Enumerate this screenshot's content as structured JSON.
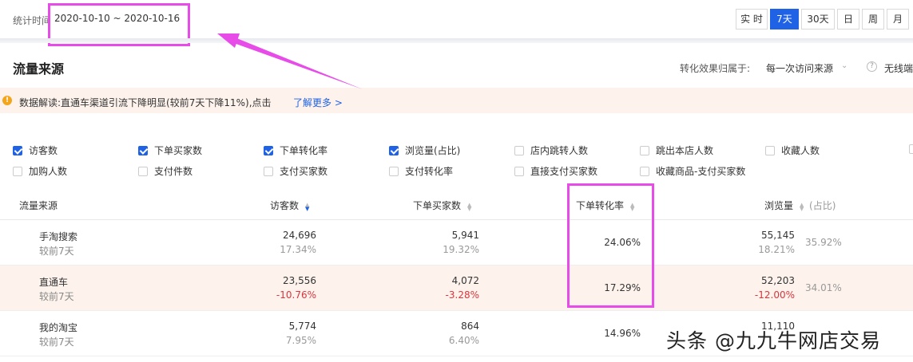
{
  "header": {
    "stat_label": "统计时间",
    "date_range": "2020-10-10 ~ 2020-10-16",
    "periods": [
      {
        "label": "实 时",
        "active": false
      },
      {
        "label": "7天",
        "active": true
      },
      {
        "label": "30天",
        "active": false
      },
      {
        "label": "日",
        "active": false
      },
      {
        "label": "周",
        "active": false
      },
      {
        "label": "月",
        "active": false
      }
    ]
  },
  "section": {
    "title": "流量来源",
    "attribution_label": "转化效果归属于:",
    "attribution_value": "每一次访问来源",
    "no_wireless": "无线端"
  },
  "notice": {
    "text": "数据解读:直通车渠道引流下降明显(较前7天下降11%),点击",
    "link": "了解更多 >"
  },
  "metrics": [
    {
      "label": "访客数",
      "checked": true
    },
    {
      "label": "下单买家数",
      "checked": true
    },
    {
      "label": "下单转化率",
      "checked": true
    },
    {
      "label": "浏览量(占比)",
      "checked": true
    },
    {
      "label": "店内跳转人数",
      "checked": false
    },
    {
      "label": "跳出本店人数",
      "checked": false
    },
    {
      "label": "收藏人数",
      "checked": false
    },
    {
      "label": "加购人数",
      "checked": false
    },
    {
      "label": "支付件数",
      "checked": false
    },
    {
      "label": "支付买家数",
      "checked": false
    },
    {
      "label": "支付转化率",
      "checked": false
    },
    {
      "label": "直接支付买家数",
      "checked": false
    },
    {
      "label": "收藏商品-支付买家数",
      "checked": false
    }
  ],
  "table": {
    "headers": {
      "source": "流量来源",
      "visitors": "访客数",
      "buyers": "下单买家数",
      "conversion": "下单转化率",
      "pageviews": "浏览量",
      "share": "(占比)"
    },
    "compare_label": "较前7天",
    "rows": [
      {
        "source": "手淘搜索",
        "visitors": "24,696",
        "visitors_change": "17.34%",
        "visitors_down": false,
        "buyers": "5,941",
        "buyers_change": "19.32%",
        "buyers_down": false,
        "conversion": "24.06%",
        "pageviews": "55,145",
        "pageviews_change": "18.21%",
        "pageviews_down": false,
        "share": "35.92%"
      },
      {
        "source": "直通车",
        "visitors": "23,556",
        "visitors_change": "-10.76%",
        "visitors_down": true,
        "buyers": "4,072",
        "buyers_change": "-3.28%",
        "buyers_down": true,
        "conversion": "17.29%",
        "pageviews": "52,203",
        "pageviews_change": "-12.00%",
        "pageviews_down": true,
        "share": "34.01%"
      },
      {
        "source": "我的淘宝",
        "visitors": "5,774",
        "visitors_change": "7.95%",
        "visitors_down": false,
        "buyers": "864",
        "buyers_change": "6.40%",
        "buyers_down": false,
        "conversion": "14.96%",
        "pageviews": "11,110",
        "pageviews_change": "",
        "pageviews_down": false,
        "share": ""
      }
    ]
  },
  "watermark": "头条 @九九牛网店交易",
  "colors": {
    "accent": "#2062e6",
    "highlight": "#e84ce8",
    "down": "#d9363e",
    "notice_bg": "#fdf3ec"
  }
}
